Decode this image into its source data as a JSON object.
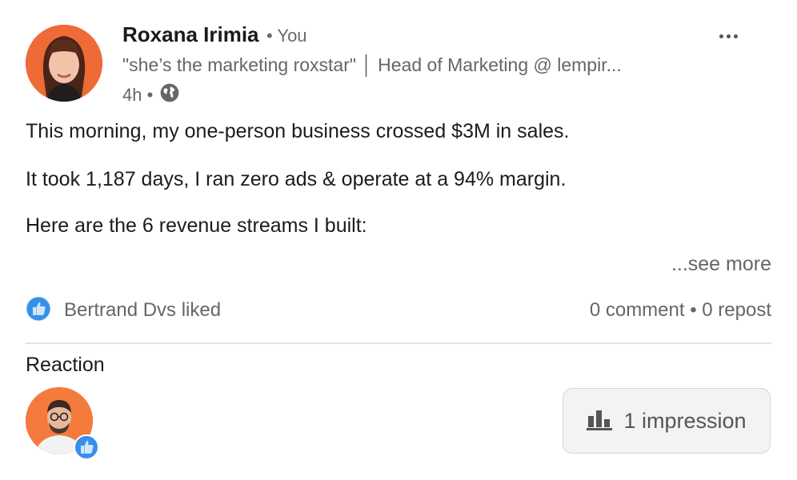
{
  "author": {
    "name": "Roxana Irimia",
    "you_label": "• You",
    "headline": "\"she’s the marketing roxstar\" │ Head of Marketing @ lempir...",
    "time": "4h •"
  },
  "post": {
    "lines": [
      "This morning, my one-person business crossed $3M in sales.",
      "It took 1,187 days, I ran zero ads & operate at a 94% margin.",
      "Here are the 6 revenue streams I built:"
    ],
    "see_more": "...see more"
  },
  "social": {
    "liked_by": "Bertrand Dvs liked",
    "counts": "0 comment • 0 repost"
  },
  "reactions": {
    "heading": "Reaction"
  },
  "impressions": {
    "label": "1 impression"
  },
  "icons": {
    "more": "more-horizontal-icon",
    "globe": "globe-icon",
    "like": "like-icon",
    "analytics": "bar-chart-icon"
  },
  "colors": {
    "like_blue": "#378fe9",
    "avatar_orange": "#ee6a37"
  }
}
